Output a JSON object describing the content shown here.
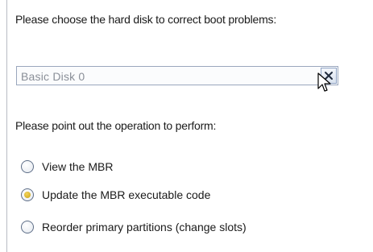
{
  "disk_section": {
    "prompt": "Please choose the hard disk to correct boot problems:",
    "selected_disk": "Basic Disk 0",
    "dropdown_icon": "close-x-icon"
  },
  "operation_section": {
    "prompt": "Please point out the operation to perform:",
    "options": [
      {
        "label": "View the MBR",
        "selected": false
      },
      {
        "label": "Update the MBR executable code",
        "selected": true
      },
      {
        "label": "Reorder primary partitions (change slots)",
        "selected": false
      }
    ]
  },
  "colors": {
    "radio_selected": "#d4af1e",
    "combo_border": "#9aa7bd"
  }
}
